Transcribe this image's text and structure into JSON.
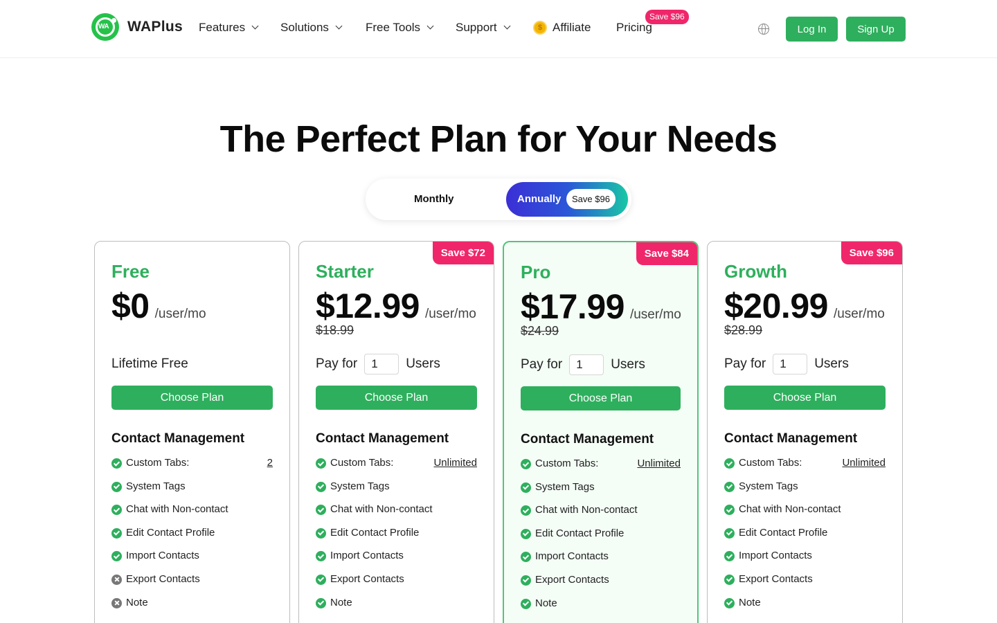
{
  "brand": {
    "name": "WAPlus",
    "logo_text": "WA"
  },
  "nav": {
    "items": [
      {
        "label": "Features"
      },
      {
        "label": "Solutions"
      },
      {
        "label": "Free Tools"
      },
      {
        "label": "Support"
      }
    ],
    "affiliate": "Affiliate",
    "pricing": "Pricing",
    "pricing_badge": "Save $96",
    "login": "Log In",
    "signup": "Sign Up",
    "icons": [
      "chevron-down-icon",
      "coin-icon",
      "globe-icon"
    ]
  },
  "hero": {
    "title": "The Perfect Plan for Your Needs",
    "toggle": {
      "monthly": "Monthly",
      "annually": "Annually",
      "annual_badge": "Save $96",
      "selected": "Annually"
    }
  },
  "colors": {
    "brand_green": "#2eaf5d",
    "badge_pink": "#f0266b",
    "pro_border": "#54c47a"
  },
  "plans": [
    {
      "name": "Free",
      "price": "$0",
      "per": "/user/mo",
      "note": "Lifetime Free",
      "cta": "Choose Plan",
      "section": "Contact Management",
      "features": [
        {
          "label": "Custom Tabs:",
          "value": "2",
          "included": true
        },
        {
          "label": "System Tags",
          "included": true
        },
        {
          "label": "Chat with Non-contact",
          "included": true
        },
        {
          "label": "Edit Contact Profile",
          "included": true
        },
        {
          "label": "Import Contacts",
          "included": true
        },
        {
          "label": "Export Contacts",
          "included": false
        },
        {
          "label": "Note",
          "included": false
        }
      ]
    },
    {
      "name": "Starter",
      "price": "$12.99",
      "per": "/user/mo",
      "old_price": "$18.99",
      "ribbon": "Save $72",
      "pay_for": "Pay for",
      "users_value": "1",
      "users": "Users",
      "cta": "Choose Plan",
      "section": "Contact Management",
      "features": [
        {
          "label": "Custom Tabs:",
          "value": "Unlimited",
          "included": true
        },
        {
          "label": "System Tags",
          "included": true
        },
        {
          "label": "Chat with Non-contact",
          "included": true
        },
        {
          "label": "Edit Contact Profile",
          "included": true
        },
        {
          "label": "Import Contacts",
          "included": true
        },
        {
          "label": "Export Contacts",
          "included": true
        },
        {
          "label": "Note",
          "included": true
        }
      ]
    },
    {
      "name": "Pro",
      "price": "$17.99",
      "per": "/user/mo",
      "old_price": "$24.99",
      "ribbon": "Save $84",
      "pay_for": "Pay for",
      "users_value": "1",
      "users": "Users",
      "cta": "Choose Plan",
      "section": "Contact Management",
      "features": [
        {
          "label": "Custom Tabs:",
          "value": "Unlimited",
          "included": true
        },
        {
          "label": "System Tags",
          "included": true
        },
        {
          "label": "Chat with Non-contact",
          "included": true
        },
        {
          "label": "Edit Contact Profile",
          "included": true
        },
        {
          "label": "Import Contacts",
          "included": true
        },
        {
          "label": "Export Contacts",
          "included": true
        },
        {
          "label": "Note",
          "included": true
        }
      ]
    },
    {
      "name": "Growth",
      "price": "$20.99",
      "per": "/user/mo",
      "old_price": "$28.99",
      "ribbon": "Save $96",
      "pay_for": "Pay for",
      "users_value": "1",
      "users": "Users",
      "cta": "Choose Plan",
      "section": "Contact Management",
      "features": [
        {
          "label": "Custom Tabs:",
          "value": "Unlimited",
          "included": true
        },
        {
          "label": "System Tags",
          "included": true
        },
        {
          "label": "Chat with Non-contact",
          "included": true
        },
        {
          "label": "Edit Contact Profile",
          "included": true
        },
        {
          "label": "Import Contacts",
          "included": true
        },
        {
          "label": "Export Contacts",
          "included": true
        },
        {
          "label": "Note",
          "included": true
        }
      ]
    }
  ]
}
